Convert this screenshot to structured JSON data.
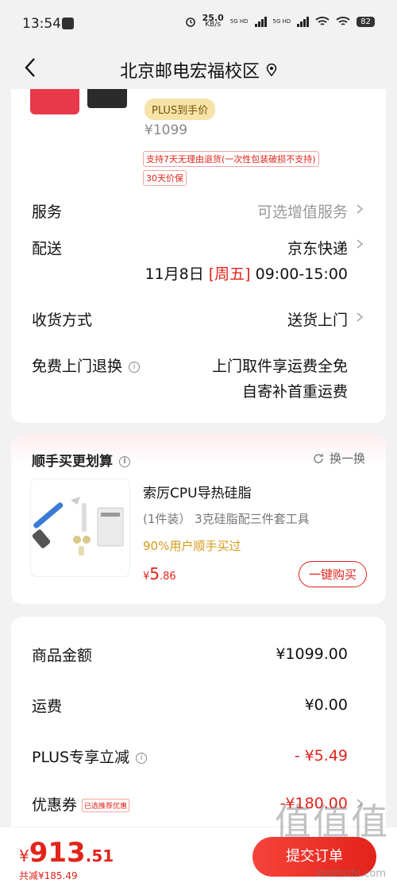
{
  "status_bar": {
    "time": "13:54",
    "speed_value": "25.0",
    "speed_unit": "KB/s",
    "net1": "5G HD",
    "net2": "5G HD",
    "battery": "82"
  },
  "nav": {
    "title": "北京邮电宏福校区"
  },
  "product": {
    "plus_tag": "PLUS到手价",
    "price": "¥1099",
    "tag_return": "支持7天无理由退货(一次性包装破损不支持)",
    "tag_price_protect": "30天价保"
  },
  "rows": {
    "service_label": "服务",
    "service_value": "可选增值服务",
    "delivery_label": "配送",
    "delivery_value": "京东快递",
    "delivery_date": "11月8日",
    "delivery_weekday": "[周五]",
    "delivery_time": "09:00-15:00",
    "receive_label": "收货方式",
    "receive_value": "送货上门",
    "return_label": "免费上门退换",
    "return_line1": "上门取件享运费全免",
    "return_line2": "自寄补首重运费"
  },
  "addon": {
    "title": "顺手买更划算",
    "swap": "换一换",
    "item_name": "索厉CPU导热硅脂",
    "item_spec": "(1件装）  3克硅脂配三件套工具",
    "item_pct": "90%用户顺手买过",
    "item_price_yen": "¥",
    "item_price_int": "5",
    "item_price_dec": ".86",
    "buy": "一键购买"
  },
  "fees": {
    "goods_label": "商品金额",
    "goods_value": "¥1099.00",
    "freight_label": "运费",
    "freight_value": "¥0.00",
    "plus_label": "PLUS专享立减",
    "plus_value": "- ¥5.49",
    "coupon_label": "优惠券",
    "coupon_tag": "已选推荐优惠",
    "coupon_value": "-¥180.00"
  },
  "bottom": {
    "total_yen": "¥",
    "total_int": "913",
    "total_dec": ".51",
    "saved": "共减¥185.49",
    "submit": "提交订单"
  },
  "watermark": {
    "logo": "值值值",
    "url": "zhizhizhi.com"
  },
  "colors": {
    "accent": "#e2231a",
    "plus_gold": "#f6e3a8",
    "background": "#f2f2f2"
  }
}
